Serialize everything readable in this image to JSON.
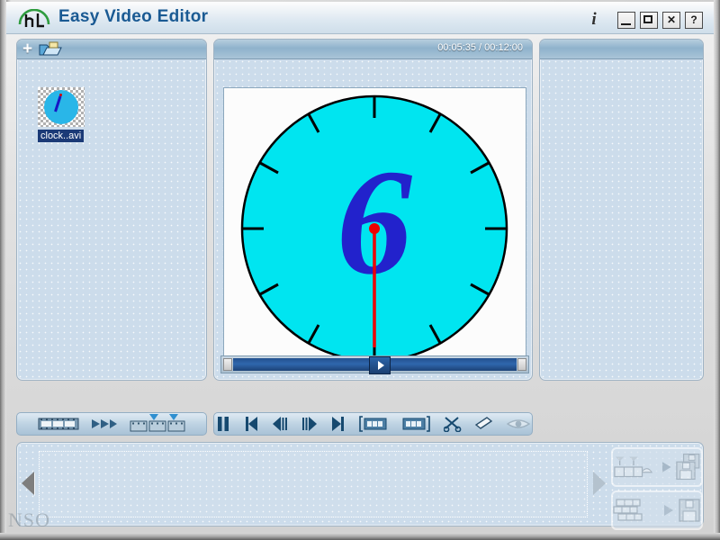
{
  "window": {
    "title": "Easy Video Editor",
    "logo_icon": "hl-arc-logo-icon",
    "controls": {
      "info_label": "i",
      "info_icon": "info-italic-icon",
      "minimize_icon": "minimize-icon",
      "maximize_icon": "maximize-icon",
      "close_label": "✕",
      "close_icon": "close-icon",
      "help_label": "?",
      "help_icon": "help-icon"
    }
  },
  "media_bin": {
    "toolbar": {
      "add_label": "+",
      "add_icon": "plus-icon",
      "open_folder_icon": "open-folder-icon"
    },
    "items": [
      {
        "name": "clock..avi",
        "thumbnail_icon": "clock-thumbnail-icon",
        "selected": true
      }
    ],
    "tools": [
      {
        "name": "filmstrip-frames-icon",
        "label": "",
        "enabled": true
      },
      {
        "name": "fast-forward-icon",
        "label": "",
        "enabled": true
      },
      {
        "name": "split-clip-icon",
        "label": "",
        "enabled": true
      }
    ]
  },
  "preview": {
    "time_display": "00:05:35 / 00:12:00",
    "current_time": "00:05:35",
    "total_time": "00:12:00",
    "scrubber": {
      "thumb_icon": "play-triangle-icon",
      "position_percent": 48
    },
    "frame": {
      "description": "analog clock face",
      "face_color": "#00e5f0",
      "numeral": "6",
      "numeral_color": "#2222cc",
      "hand_color": "#ee0000",
      "tick_count": 12,
      "background_color": "#fcfcfc"
    }
  },
  "transport": {
    "buttons": [
      {
        "name": "pause-button",
        "icon": "pause-icon",
        "enabled": true
      },
      {
        "name": "skip-to-start-button",
        "icon": "skip-start-icon",
        "enabled": true
      },
      {
        "name": "step-back-button",
        "icon": "step-back-icon",
        "enabled": true
      },
      {
        "name": "step-forward-button",
        "icon": "step-forward-icon",
        "enabled": true
      },
      {
        "name": "skip-to-end-button",
        "icon": "skip-end-icon",
        "enabled": true
      },
      {
        "name": "mark-in-button",
        "icon": "mark-in-filmstrip-icon",
        "enabled": true
      },
      {
        "name": "mark-out-button",
        "icon": "mark-out-filmstrip-icon",
        "enabled": true
      },
      {
        "name": "cut-button",
        "icon": "scissors-icon",
        "enabled": true
      },
      {
        "name": "erase-button",
        "icon": "eraser-icon",
        "enabled": true
      },
      {
        "name": "preview-button",
        "icon": "eye-icon",
        "enabled": false
      }
    ]
  },
  "right_panel": {
    "header_label": "",
    "content": ""
  },
  "timeline": {
    "scroll_left_icon": "arrow-left-icon",
    "scroll_right_icon": "arrow-right-icon",
    "clips": [],
    "export_buttons": [
      {
        "name": "export-timeline-button",
        "source_icon": "filmstrip-markers-icon",
        "arrow_icon": "arrow-right-icon",
        "target_icon": "floppy-disks-icon",
        "enabled": false
      },
      {
        "name": "export-batch-button",
        "source_icon": "stacked-clips-icon",
        "arrow_icon": "arrow-right-icon",
        "target_icon": "floppy-disk-icon",
        "enabled": false
      }
    ]
  },
  "watermark": {
    "text": "NSO"
  }
}
